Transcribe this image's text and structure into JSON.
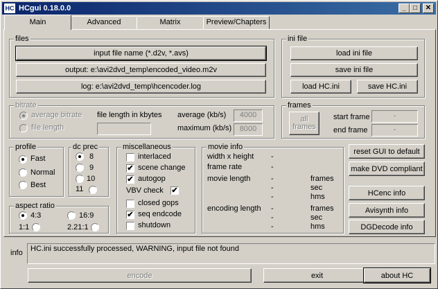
{
  "window": {
    "title": "HCgui 0.18.0.0",
    "icon_text": "HC"
  },
  "titlebar_buttons": {
    "minimize": "_",
    "maximize": "□",
    "close": "✕"
  },
  "tabs": [
    {
      "label": "Main"
    },
    {
      "label": "Advanced"
    },
    {
      "label": "Matrix"
    },
    {
      "label": "Preview/Chapters"
    }
  ],
  "files": {
    "label": "files",
    "input": "input file name (*.d2v, *.avs)",
    "output": "output: e:\\avi2dvd_temp\\encoded_video.m2v",
    "log": "log: e:\\avi2dvd_temp\\hcencoder.log"
  },
  "ini_file": {
    "label": "ini file",
    "load": "load ini file",
    "save": "save ini file",
    "load_hc": "load HC.ini",
    "save_hc": "save HC.ini"
  },
  "bitrate": {
    "label": "bitrate",
    "average_bitrate": "average bitrate",
    "file_length": "file length",
    "file_length_kbytes": "file length in kbytes",
    "average_label": "average (kb/s)",
    "average_value": "4000",
    "maximum_label": "maximum (kb/s)",
    "maximum_value": "8000"
  },
  "frames": {
    "label": "frames",
    "all_frames_1": "all",
    "all_frames_2": "frames",
    "start_frame": "start frame",
    "start_value": "-",
    "end_frame": "end frame",
    "end_value": "-"
  },
  "profile": {
    "label": "profile",
    "fast": "Fast",
    "normal": "Normal",
    "best": "Best"
  },
  "dc_prec": {
    "label": "dc prec",
    "v8": "8",
    "v9": "9",
    "v10": "10",
    "v11": "11"
  },
  "misc": {
    "label": "miscellaneous",
    "interlaced": "interlaced",
    "scene_change": "scene change",
    "autogop": "autogop",
    "vbv_check": "VBV check",
    "closed_gops": "closed gops",
    "seq_endcode": "seq endcode",
    "shutdown": "shutdown",
    "check_mark": "✔"
  },
  "movie_info": {
    "label": "movie info",
    "wxh": "width x height",
    "wxh_value": "-",
    "frame_rate": "frame rate",
    "frame_rate_value": "-",
    "movie_length": "movie length",
    "ml_v1": "-",
    "ml_v2": "-",
    "ml_v3": "-",
    "ml_u1": "frames",
    "ml_u2": "sec",
    "ml_u3": "hms",
    "encoding_length": "encoding length",
    "el_v1": "-",
    "el_v2": "-",
    "el_v3": "-",
    "el_u1": "frames",
    "el_u2": "sec",
    "el_u3": "hms"
  },
  "aspect": {
    "label": "aspect ratio",
    "r43": "4:3",
    "r169": "16:9",
    "r11": "1:1",
    "r221": "2.21:1"
  },
  "side_buttons": {
    "reset": "reset GUI to default",
    "dvd": "make DVD compliant",
    "hcenc": "HCenc info",
    "avisynth": "Avisynth info",
    "dgdecode": "DGDecode info"
  },
  "info": {
    "label": "info",
    "message": "HC.ini successfully processed, WARNING, input file not found"
  },
  "bottom": {
    "encode": "encode",
    "exit": "exit",
    "about": "about HC"
  }
}
